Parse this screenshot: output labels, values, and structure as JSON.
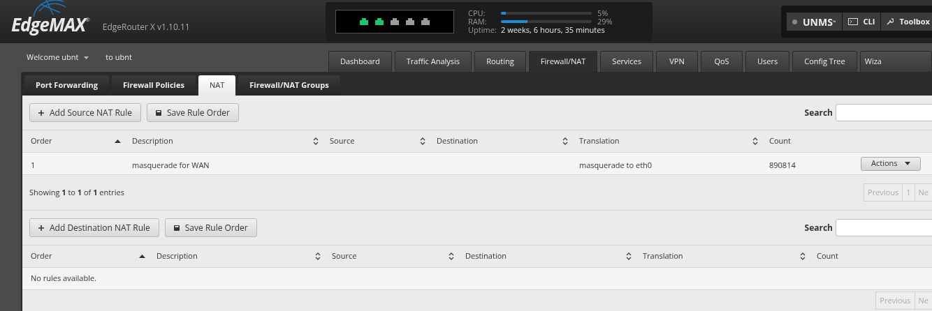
{
  "header": {
    "logo": "EdgeMAX",
    "logo_mark": "®",
    "model": "EdgeRouter X v1.10.11"
  },
  "status": {
    "ports": [
      {
        "up": true
      },
      {
        "up": true
      },
      {
        "up": false
      },
      {
        "up": false
      },
      {
        "up": false
      }
    ],
    "meters": [
      {
        "label": "CPU:",
        "level": 0.05,
        "reading": "5%"
      },
      {
        "label": "RAM:",
        "level": 0.29,
        "reading": "29%"
      }
    ],
    "uptime_label": "Uptime:",
    "uptime": "2 weeks, 6 hours, 35 minutes"
  },
  "top_buttons": [
    {
      "kind": "unms",
      "label": "UNMS",
      "mark": "™",
      "connected": false
    },
    {
      "kind": "cli",
      "label": "CLI"
    },
    {
      "kind": "toolbox",
      "label": "Toolbox"
    }
  ],
  "user": {
    "welcome": "Welcome ubnt",
    "to": "to ubnt"
  },
  "nav_tabs": [
    {
      "label": "Dashboard",
      "selected": false
    },
    {
      "label": "Traffic Analysis",
      "selected": false
    },
    {
      "label": "Routing",
      "selected": false
    },
    {
      "label": "Firewall/NAT",
      "selected": true
    },
    {
      "label": "Services",
      "selected": false
    },
    {
      "label": "VPN",
      "selected": false
    },
    {
      "label": "QoS",
      "selected": false
    },
    {
      "label": "Users",
      "selected": false
    },
    {
      "label": "Config Tree",
      "selected": false
    },
    {
      "label": "Wiza",
      "selected": false
    }
  ],
  "sub_tabs": [
    {
      "label": "Port Forwarding",
      "selected": false
    },
    {
      "label": "Firewall Policies",
      "selected": false
    },
    {
      "label": "NAT",
      "selected": true
    },
    {
      "label": "Firewall/NAT Groups",
      "selected": false
    }
  ],
  "sections": [
    {
      "buttons": [
        {
          "kind": "add",
          "label": "Add Source NAT Rule"
        },
        {
          "kind": "save",
          "label": "Save Rule Order"
        }
      ],
      "search_label": "Search",
      "columns": [
        {
          "label": "Order",
          "kind": "ascending"
        },
        {
          "label": "Description",
          "kind": "sortable"
        },
        {
          "label": "Source",
          "kind": "sortable"
        },
        {
          "label": "Destination",
          "kind": "sortable"
        },
        {
          "label": "Translation",
          "kind": "sortable"
        },
        {
          "label": "Count",
          "kind": "plain"
        }
      ],
      "rows": [
        {
          "cells": [
            "1",
            "masquerade for WAN",
            "",
            "",
            "masquerade to eth0",
            "890814"
          ],
          "action": "Actions"
        }
      ],
      "info": "Showing **1** to **1** of **1** entries",
      "pagination": [
        "Previous",
        "1",
        "Ne"
      ]
    },
    {
      "buttons": [
        {
          "kind": "add",
          "label": "Add Destination NAT Rule"
        },
        {
          "kind": "save",
          "label": "Save Rule Order"
        }
      ],
      "search_label": "Search",
      "columns": [
        {
          "label": "Order",
          "kind": "ascending"
        },
        {
          "label": "Description",
          "kind": "sortable"
        },
        {
          "label": "Source",
          "kind": "sortable"
        },
        {
          "label": "Destination",
          "kind": "sortable"
        },
        {
          "label": "Translation",
          "kind": "sortable"
        },
        {
          "label": "Count",
          "kind": "plain"
        }
      ],
      "empty": "No rules available.",
      "pagination": [
        "Previous",
        "Ne"
      ]
    }
  ]
}
